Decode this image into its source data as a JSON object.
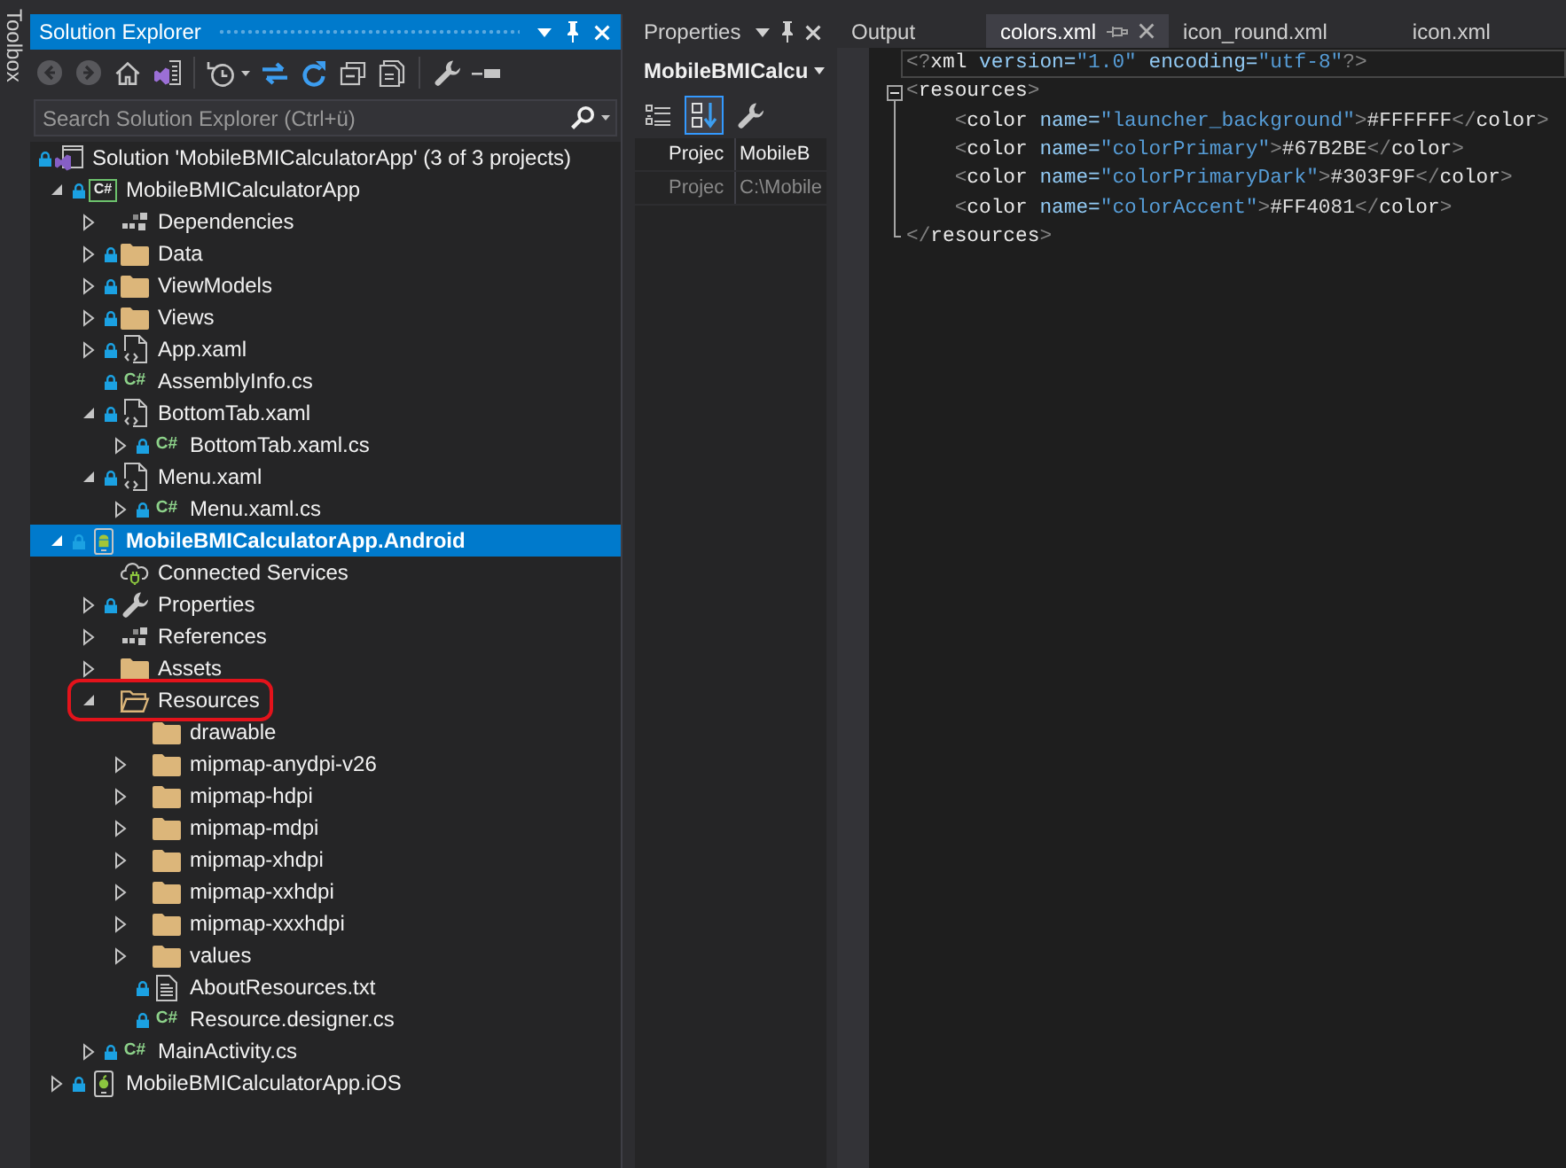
{
  "toolbox": {
    "label": "Toolbox"
  },
  "solution_explorer": {
    "title": "Solution Explorer",
    "active": true,
    "toolbar": [
      [
        {
          "kind": "back",
          "disabled": true
        },
        {
          "kind": "forward",
          "disabled": true
        },
        {
          "kind": "home",
          "disabled": false
        },
        {
          "kind": "switch-views",
          "disabled": false
        }
      ],
      [
        {
          "kind": "history",
          "disabled": false
        },
        {
          "kind": "sync",
          "disabled": false
        },
        {
          "kind": "refresh",
          "disabled": false
        },
        {
          "kind": "collapse-all",
          "disabled": false
        },
        {
          "kind": "show-all-files",
          "disabled": false
        }
      ],
      [
        {
          "kind": "properties",
          "disabled": false
        },
        {
          "kind": "preview",
          "disabled": false
        }
      ]
    ],
    "search": {
      "placeholder": "Search Solution Explorer (Ctrl+ü)"
    },
    "tree": [
      {
        "label": "Solution 'MobileBMICalculatorApp' (3 of 3 projects)",
        "kind": "solution",
        "locked": true,
        "selected": false,
        "startup": false,
        "highlighted": false,
        "children": [
          {
            "label": "MobileBMICalculatorApp",
            "kind": "csharp-project",
            "badge": "C#",
            "expanded": true,
            "locked": true,
            "selected": false,
            "startup": false,
            "highlighted": false,
            "children": [
              {
                "label": "Dependencies",
                "kind": "references",
                "expanded": false,
                "locked": false,
                "selected": false,
                "startup": false,
                "highlighted": false
              },
              {
                "label": "Data",
                "kind": "folder",
                "expanded": false,
                "locked": true,
                "selected": false,
                "startup": false,
                "highlighted": false
              },
              {
                "label": "ViewModels",
                "kind": "folder",
                "expanded": false,
                "locked": true,
                "selected": false,
                "startup": false,
                "highlighted": false
              },
              {
                "label": "Views",
                "kind": "folder",
                "expanded": false,
                "locked": true,
                "selected": false,
                "startup": false,
                "highlighted": false
              },
              {
                "label": "App.xaml",
                "kind": "xaml",
                "expanded": false,
                "locked": true,
                "selected": false,
                "startup": false,
                "highlighted": false
              },
              {
                "label": "AssemblyInfo.cs",
                "kind": "csharp",
                "badge": "C#",
                "locked": true,
                "selected": false,
                "startup": false,
                "highlighted": false
              },
              {
                "label": "BottomTab.xaml",
                "kind": "xaml",
                "expanded": true,
                "locked": true,
                "selected": false,
                "startup": false,
                "highlighted": false,
                "children": [
                  {
                    "label": "BottomTab.xaml.cs",
                    "kind": "csharp",
                    "badge": "C#",
                    "expanded": false,
                    "locked": true,
                    "selected": false,
                    "startup": false,
                    "highlighted": false
                  }
                ]
              },
              {
                "label": "Menu.xaml",
                "kind": "xaml",
                "expanded": true,
                "locked": true,
                "selected": false,
                "startup": false,
                "highlighted": false,
                "children": [
                  {
                    "label": "Menu.xaml.cs",
                    "kind": "csharp",
                    "badge": "C#",
                    "expanded": false,
                    "locked": true,
                    "selected": false,
                    "startup": false,
                    "highlighted": false
                  }
                ]
              }
            ]
          },
          {
            "label": "MobileBMICalculatorApp.Android",
            "kind": "android-project",
            "expanded": true,
            "locked": true,
            "selected": true,
            "startup": true,
            "highlighted": false,
            "children": [
              {
                "label": "Connected Services",
                "kind": "connected-services",
                "locked": false,
                "selected": false,
                "startup": false,
                "highlighted": false
              },
              {
                "label": "Properties",
                "kind": "wrench",
                "expanded": false,
                "locked": true,
                "selected": false,
                "startup": false,
                "highlighted": false
              },
              {
                "label": "References",
                "kind": "references",
                "expanded": false,
                "locked": false,
                "selected": false,
                "startup": false,
                "highlighted": false
              },
              {
                "label": "Assets",
                "kind": "folder",
                "expanded": false,
                "locked": false,
                "selected": false,
                "startup": false,
                "highlighted": false
              },
              {
                "label": "Resources",
                "kind": "folder",
                "expanded": true,
                "locked": false,
                "selected": false,
                "startup": false,
                "highlighted": true,
                "children": [
                  {
                    "label": "drawable",
                    "kind": "folder",
                    "locked": false,
                    "selected": false,
                    "startup": false,
                    "highlighted": false
                  },
                  {
                    "label": "mipmap-anydpi-v26",
                    "kind": "folder",
                    "expanded": false,
                    "locked": false,
                    "selected": false,
                    "startup": false,
                    "highlighted": false
                  },
                  {
                    "label": "mipmap-hdpi",
                    "kind": "folder",
                    "expanded": false,
                    "locked": false,
                    "selected": false,
                    "startup": false,
                    "highlighted": false
                  },
                  {
                    "label": "mipmap-mdpi",
                    "kind": "folder",
                    "expanded": false,
                    "locked": false,
                    "selected": false,
                    "startup": false,
                    "highlighted": false
                  },
                  {
                    "label": "mipmap-xhdpi",
                    "kind": "folder",
                    "expanded": false,
                    "locked": false,
                    "selected": false,
                    "startup": false,
                    "highlighted": false
                  },
                  {
                    "label": "mipmap-xxhdpi",
                    "kind": "folder",
                    "expanded": false,
                    "locked": false,
                    "selected": false,
                    "startup": false,
                    "highlighted": false
                  },
                  {
                    "label": "mipmap-xxxhdpi",
                    "kind": "folder",
                    "expanded": false,
                    "locked": false,
                    "selected": false,
                    "startup": false,
                    "highlighted": false
                  },
                  {
                    "label": "values",
                    "kind": "folder",
                    "expanded": false,
                    "locked": false,
                    "selected": false,
                    "startup": false,
                    "highlighted": false
                  },
                  {
                    "label": "AboutResources.txt",
                    "kind": "text-file",
                    "locked": true,
                    "selected": false,
                    "startup": false,
                    "highlighted": false
                  },
                  {
                    "label": "Resource.designer.cs",
                    "kind": "csharp",
                    "badge": "C#",
                    "locked": true,
                    "selected": false,
                    "startup": false,
                    "highlighted": false
                  }
                ]
              },
              {
                "label": "MainActivity.cs",
                "kind": "csharp",
                "badge": "C#",
                "expanded": false,
                "locked": true,
                "selected": false,
                "startup": false,
                "highlighted": false
              }
            ]
          },
          {
            "label": "MobileBMICalculatorApp.iOS",
            "kind": "ios-project",
            "expanded": false,
            "locked": true,
            "selected": false,
            "startup": false,
            "highlighted": false
          }
        ]
      }
    ]
  },
  "properties": {
    "title": "Properties",
    "active": false,
    "object": "MobileBMICalcu",
    "toolbar": [
      {
        "kind": "categorized",
        "selected": false
      },
      {
        "kind": "alphabetical",
        "selected": true
      },
      {
        "kind": "property-pages",
        "selected": false
      }
    ],
    "rows": [
      {
        "name": "Projec",
        "value": "MobileB",
        "readonly": false
      },
      {
        "name": "Projec",
        "value": "C:\\Mobile",
        "readonly": true
      }
    ]
  },
  "editor": {
    "tabs": [
      {
        "label": "Output",
        "selected": false
      },
      {
        "label": "colors.xml",
        "selected": true
      },
      {
        "label": "icon_round.xml",
        "selected": false
      },
      {
        "label": "icon.xml",
        "selected": false
      }
    ],
    "document": [
      {
        "current": true,
        "tokens": [
          {
            "text": "<?",
            "kind": "delimiter"
          },
          {
            "text": "xml",
            "kind": "element"
          },
          {
            "text": " version=",
            "kind": "attribute"
          },
          {
            "text": "\"1.0\"",
            "kind": "value"
          },
          {
            "text": " encoding=",
            "kind": "attribute"
          },
          {
            "text": "\"utf-8\"",
            "kind": "value"
          },
          {
            "text": "?>",
            "kind": "delimiter"
          }
        ]
      },
      {
        "current": false,
        "expanded": true,
        "tokens": [
          {
            "text": "<",
            "kind": "delimiter"
          },
          {
            "text": "resources",
            "kind": "element"
          },
          {
            "text": ">",
            "kind": "delimiter"
          }
        ],
        "children": [
          {
            "current": false,
            "tokens": [
              {
                "text": "<",
                "kind": "delimiter"
              },
              {
                "text": "color",
                "kind": "element"
              },
              {
                "text": " name=",
                "kind": "attribute"
              },
              {
                "text": "\"launcher_background\"",
                "kind": "value"
              },
              {
                "text": ">",
                "kind": "delimiter"
              },
              {
                "text": "#FFFFFF",
                "kind": "text"
              },
              {
                "text": "</",
                "kind": "delimiter"
              },
              {
                "text": "color",
                "kind": "element"
              },
              {
                "text": ">",
                "kind": "delimiter"
              }
            ]
          },
          {
            "current": false,
            "tokens": [
              {
                "text": "<",
                "kind": "delimiter"
              },
              {
                "text": "color",
                "kind": "element"
              },
              {
                "text": " name=",
                "kind": "attribute"
              },
              {
                "text": "\"colorPrimary\"",
                "kind": "value"
              },
              {
                "text": ">",
                "kind": "delimiter"
              },
              {
                "text": "#67B2BE",
                "kind": "text"
              },
              {
                "text": "</",
                "kind": "delimiter"
              },
              {
                "text": "color",
                "kind": "element"
              },
              {
                "text": ">",
                "kind": "delimiter"
              }
            ]
          },
          {
            "current": false,
            "tokens": [
              {
                "text": "<",
                "kind": "delimiter"
              },
              {
                "text": "color",
                "kind": "element"
              },
              {
                "text": " name=",
                "kind": "attribute"
              },
              {
                "text": "\"colorPrimaryDark\"",
                "kind": "value"
              },
              {
                "text": ">",
                "kind": "delimiter"
              },
              {
                "text": "#303F9F",
                "kind": "text"
              },
              {
                "text": "</",
                "kind": "delimiter"
              },
              {
                "text": "color",
                "kind": "element"
              },
              {
                "text": ">",
                "kind": "delimiter"
              }
            ]
          },
          {
            "current": false,
            "tokens": [
              {
                "text": "<",
                "kind": "delimiter"
              },
              {
                "text": "color",
                "kind": "element"
              },
              {
                "text": " name=",
                "kind": "attribute"
              },
              {
                "text": "\"colorAccent\"",
                "kind": "value"
              },
              {
                "text": ">",
                "kind": "delimiter"
              },
              {
                "text": "#FF4081",
                "kind": "text"
              },
              {
                "text": "</",
                "kind": "delimiter"
              },
              {
                "text": "color",
                "kind": "element"
              },
              {
                "text": ">",
                "kind": "delimiter"
              }
            ]
          }
        ],
        "closing": {
          "current": false,
          "tokens": [
            {
              "text": "</",
              "kind": "delimiter"
            },
            {
              "text": "resources",
              "kind": "element"
            },
            {
              "text": ">",
              "kind": "delimiter"
            }
          ]
        }
      }
    ]
  }
}
